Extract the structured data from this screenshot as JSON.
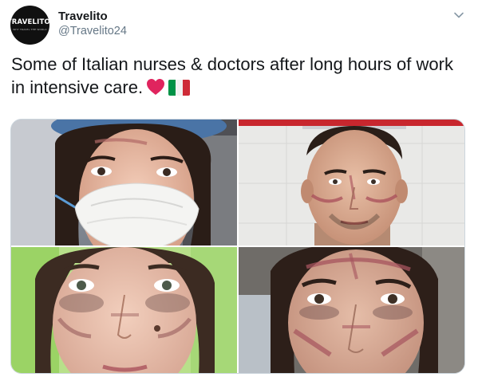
{
  "tweet": {
    "author": {
      "display_name": "Travelito",
      "handle": "@Travelito24",
      "avatar_text": "TRAVELITO.",
      "avatar_subtext": "WHY TRAVEL THE WORLD"
    },
    "text": "Some of Italian nurses & doctors after long hours of work in intensive care.",
    "emojis": [
      "heart-emoji",
      "italian-flag-emoji"
    ],
    "menu_icon": "chevron-down-icon"
  },
  "media": {
    "layout": "2x2 grid",
    "photos": [
      {
        "name": "photo-nurse-with-mask"
      },
      {
        "name": "photo-doctor-with-face-marks"
      },
      {
        "name": "photo-nurse-bruised-face"
      },
      {
        "name": "photo-nurse-with-face-marks"
      }
    ]
  },
  "colors": {
    "text": "#14171a",
    "secondary": "#657786",
    "border": "#ccd6dd",
    "heart": "#e0245e",
    "flag_green": "#009246",
    "flag_white": "#f1f2f1",
    "flag_red": "#ce2b37"
  }
}
